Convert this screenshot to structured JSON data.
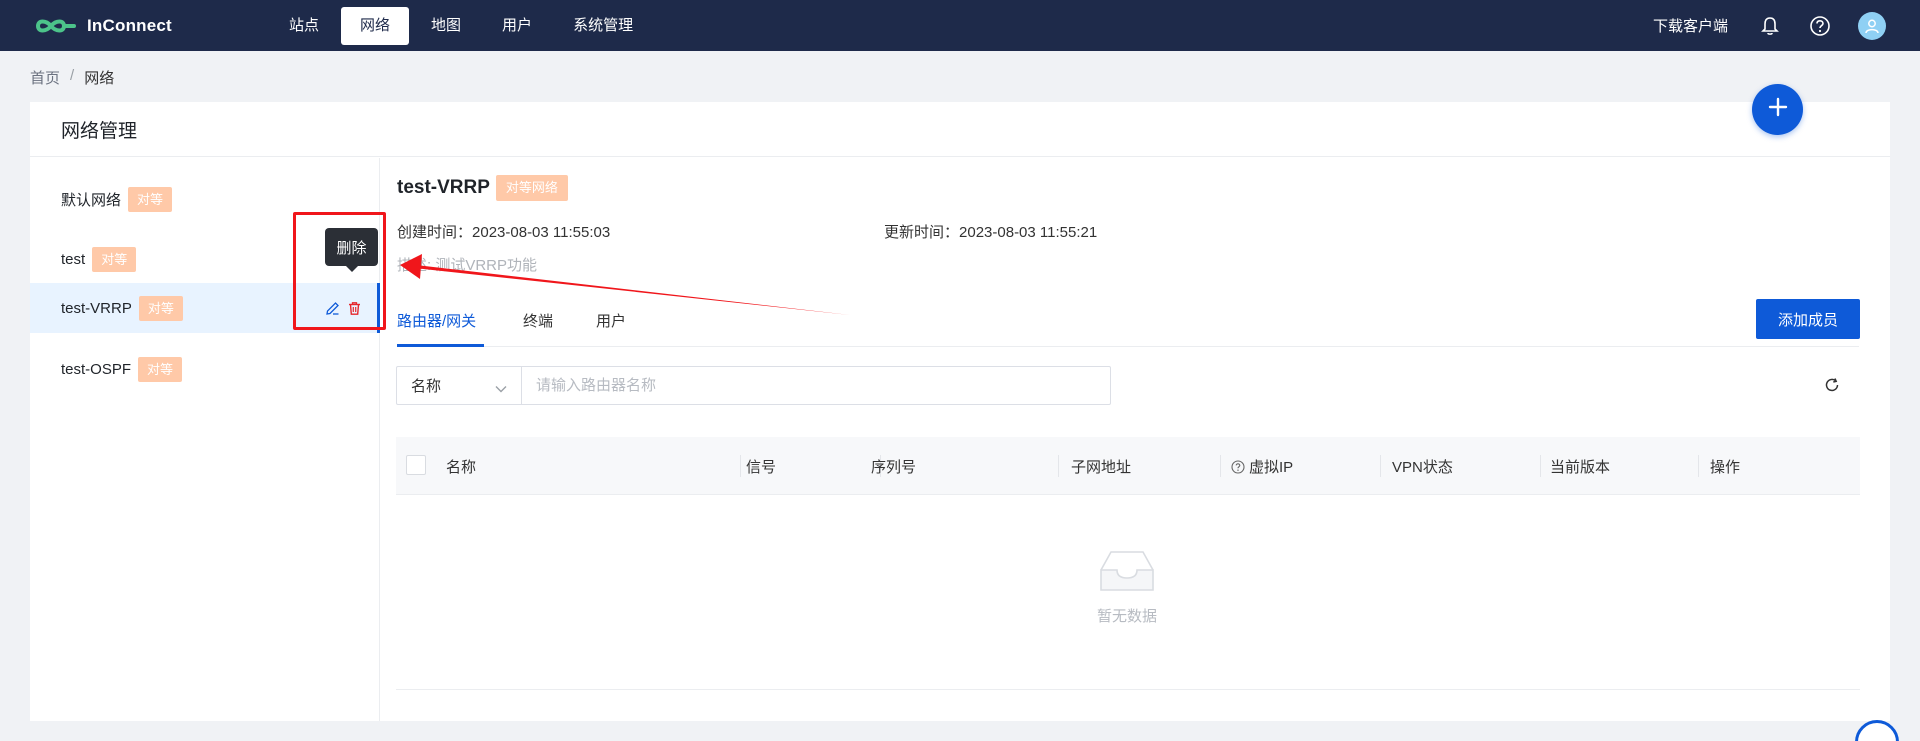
{
  "app": {
    "brand_name": "InConnect",
    "accent_color": "#0e5ad8",
    "nav_bg": "#1e2a4a",
    "tag_color": "#ffc9a8"
  },
  "nav": {
    "items": [
      {
        "label": "站点",
        "active": false
      },
      {
        "label": "网络",
        "active": true
      },
      {
        "label": "地图",
        "active": false
      },
      {
        "label": "用户",
        "active": false
      },
      {
        "label": "系统管理",
        "active": false
      }
    ],
    "download_label": "下载客户端",
    "icons": [
      "bell-icon",
      "help-icon",
      "user-avatar-icon"
    ]
  },
  "breadcrumb": {
    "home": "首页",
    "separator": "/",
    "current": "网络"
  },
  "card": {
    "title": "网络管理"
  },
  "networks": [
    {
      "name": "默认网络",
      "tag": "对等",
      "selected": false
    },
    {
      "name": "test",
      "tag": "对等",
      "selected": false
    },
    {
      "name": "test-VRRP",
      "tag": "对等",
      "selected": true
    },
    {
      "name": "test-OSPF",
      "tag": "对等",
      "selected": false
    }
  ],
  "tooltip": {
    "delete": "删除"
  },
  "detail": {
    "name": "test-VRRP",
    "type_tag": "对等网络",
    "created_label": "创建时间：",
    "created_value": "2023-08-03 11:55:03",
    "updated_label": "更新时间：",
    "updated_value": "2023-08-03 11:55:21",
    "description": "描述: 测试VRRP功能"
  },
  "tabs": [
    {
      "label": "路由器/网关",
      "active": true
    },
    {
      "label": "终端",
      "active": false
    },
    {
      "label": "用户",
      "active": false
    }
  ],
  "add_member_label": "添加成员",
  "filter": {
    "field_label": "名称",
    "placeholder": "请输入路由器名称"
  },
  "table": {
    "columns": [
      "名称",
      "信号",
      "序列号",
      "子网地址",
      "虚拟IP",
      "VPN状态",
      "当前版本",
      "操作"
    ],
    "empty_text": "暂无数据"
  }
}
